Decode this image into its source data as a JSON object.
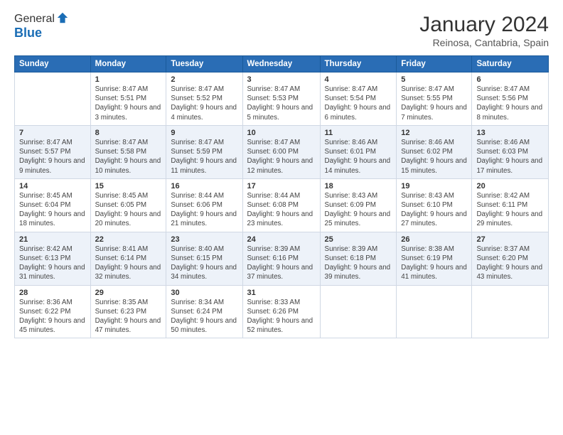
{
  "header": {
    "logo_general": "General",
    "logo_blue": "Blue",
    "month_title": "January 2024",
    "location": "Reinosa, Cantabria, Spain"
  },
  "days_of_week": [
    "Sunday",
    "Monday",
    "Tuesday",
    "Wednesday",
    "Thursday",
    "Friday",
    "Saturday"
  ],
  "weeks": [
    [
      {
        "day": "",
        "sunrise": "",
        "sunset": "",
        "daylight": ""
      },
      {
        "day": "1",
        "sunrise": "Sunrise: 8:47 AM",
        "sunset": "Sunset: 5:51 PM",
        "daylight": "Daylight: 9 hours and 3 minutes."
      },
      {
        "day": "2",
        "sunrise": "Sunrise: 8:47 AM",
        "sunset": "Sunset: 5:52 PM",
        "daylight": "Daylight: 9 hours and 4 minutes."
      },
      {
        "day": "3",
        "sunrise": "Sunrise: 8:47 AM",
        "sunset": "Sunset: 5:53 PM",
        "daylight": "Daylight: 9 hours and 5 minutes."
      },
      {
        "day": "4",
        "sunrise": "Sunrise: 8:47 AM",
        "sunset": "Sunset: 5:54 PM",
        "daylight": "Daylight: 9 hours and 6 minutes."
      },
      {
        "day": "5",
        "sunrise": "Sunrise: 8:47 AM",
        "sunset": "Sunset: 5:55 PM",
        "daylight": "Daylight: 9 hours and 7 minutes."
      },
      {
        "day": "6",
        "sunrise": "Sunrise: 8:47 AM",
        "sunset": "Sunset: 5:56 PM",
        "daylight": "Daylight: 9 hours and 8 minutes."
      }
    ],
    [
      {
        "day": "7",
        "sunrise": "Sunrise: 8:47 AM",
        "sunset": "Sunset: 5:57 PM",
        "daylight": "Daylight: 9 hours and 9 minutes."
      },
      {
        "day": "8",
        "sunrise": "Sunrise: 8:47 AM",
        "sunset": "Sunset: 5:58 PM",
        "daylight": "Daylight: 9 hours and 10 minutes."
      },
      {
        "day": "9",
        "sunrise": "Sunrise: 8:47 AM",
        "sunset": "Sunset: 5:59 PM",
        "daylight": "Daylight: 9 hours and 11 minutes."
      },
      {
        "day": "10",
        "sunrise": "Sunrise: 8:47 AM",
        "sunset": "Sunset: 6:00 PM",
        "daylight": "Daylight: 9 hours and 12 minutes."
      },
      {
        "day": "11",
        "sunrise": "Sunrise: 8:46 AM",
        "sunset": "Sunset: 6:01 PM",
        "daylight": "Daylight: 9 hours and 14 minutes."
      },
      {
        "day": "12",
        "sunrise": "Sunrise: 8:46 AM",
        "sunset": "Sunset: 6:02 PM",
        "daylight": "Daylight: 9 hours and 15 minutes."
      },
      {
        "day": "13",
        "sunrise": "Sunrise: 8:46 AM",
        "sunset": "Sunset: 6:03 PM",
        "daylight": "Daylight: 9 hours and 17 minutes."
      }
    ],
    [
      {
        "day": "14",
        "sunrise": "Sunrise: 8:45 AM",
        "sunset": "Sunset: 6:04 PM",
        "daylight": "Daylight: 9 hours and 18 minutes."
      },
      {
        "day": "15",
        "sunrise": "Sunrise: 8:45 AM",
        "sunset": "Sunset: 6:05 PM",
        "daylight": "Daylight: 9 hours and 20 minutes."
      },
      {
        "day": "16",
        "sunrise": "Sunrise: 8:44 AM",
        "sunset": "Sunset: 6:06 PM",
        "daylight": "Daylight: 9 hours and 21 minutes."
      },
      {
        "day": "17",
        "sunrise": "Sunrise: 8:44 AM",
        "sunset": "Sunset: 6:08 PM",
        "daylight": "Daylight: 9 hours and 23 minutes."
      },
      {
        "day": "18",
        "sunrise": "Sunrise: 8:43 AM",
        "sunset": "Sunset: 6:09 PM",
        "daylight": "Daylight: 9 hours and 25 minutes."
      },
      {
        "day": "19",
        "sunrise": "Sunrise: 8:43 AM",
        "sunset": "Sunset: 6:10 PM",
        "daylight": "Daylight: 9 hours and 27 minutes."
      },
      {
        "day": "20",
        "sunrise": "Sunrise: 8:42 AM",
        "sunset": "Sunset: 6:11 PM",
        "daylight": "Daylight: 9 hours and 29 minutes."
      }
    ],
    [
      {
        "day": "21",
        "sunrise": "Sunrise: 8:42 AM",
        "sunset": "Sunset: 6:13 PM",
        "daylight": "Daylight: 9 hours and 31 minutes."
      },
      {
        "day": "22",
        "sunrise": "Sunrise: 8:41 AM",
        "sunset": "Sunset: 6:14 PM",
        "daylight": "Daylight: 9 hours and 32 minutes."
      },
      {
        "day": "23",
        "sunrise": "Sunrise: 8:40 AM",
        "sunset": "Sunset: 6:15 PM",
        "daylight": "Daylight: 9 hours and 34 minutes."
      },
      {
        "day": "24",
        "sunrise": "Sunrise: 8:39 AM",
        "sunset": "Sunset: 6:16 PM",
        "daylight": "Daylight: 9 hours and 37 minutes."
      },
      {
        "day": "25",
        "sunrise": "Sunrise: 8:39 AM",
        "sunset": "Sunset: 6:18 PM",
        "daylight": "Daylight: 9 hours and 39 minutes."
      },
      {
        "day": "26",
        "sunrise": "Sunrise: 8:38 AM",
        "sunset": "Sunset: 6:19 PM",
        "daylight": "Daylight: 9 hours and 41 minutes."
      },
      {
        "day": "27",
        "sunrise": "Sunrise: 8:37 AM",
        "sunset": "Sunset: 6:20 PM",
        "daylight": "Daylight: 9 hours and 43 minutes."
      }
    ],
    [
      {
        "day": "28",
        "sunrise": "Sunrise: 8:36 AM",
        "sunset": "Sunset: 6:22 PM",
        "daylight": "Daylight: 9 hours and 45 minutes."
      },
      {
        "day": "29",
        "sunrise": "Sunrise: 8:35 AM",
        "sunset": "Sunset: 6:23 PM",
        "daylight": "Daylight: 9 hours and 47 minutes."
      },
      {
        "day": "30",
        "sunrise": "Sunrise: 8:34 AM",
        "sunset": "Sunset: 6:24 PM",
        "daylight": "Daylight: 9 hours and 50 minutes."
      },
      {
        "day": "31",
        "sunrise": "Sunrise: 8:33 AM",
        "sunset": "Sunset: 6:26 PM",
        "daylight": "Daylight: 9 hours and 52 minutes."
      },
      {
        "day": "",
        "sunrise": "",
        "sunset": "",
        "daylight": ""
      },
      {
        "day": "",
        "sunrise": "",
        "sunset": "",
        "daylight": ""
      },
      {
        "day": "",
        "sunrise": "",
        "sunset": "",
        "daylight": ""
      }
    ]
  ]
}
